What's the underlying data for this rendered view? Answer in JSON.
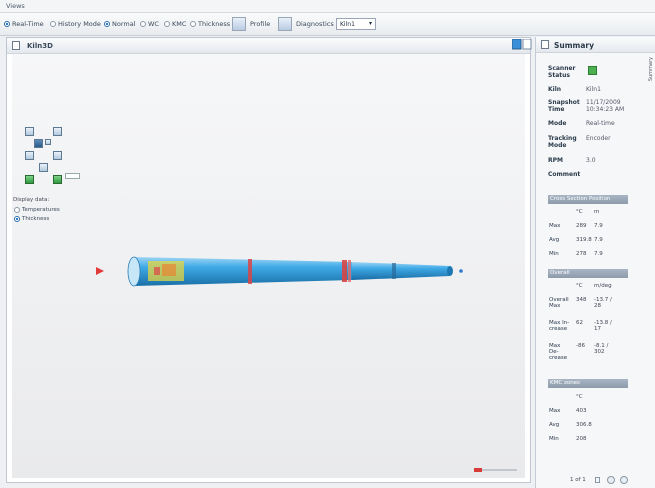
{
  "menu": {
    "label": "Views"
  },
  "toolbar": {
    "modes": [
      {
        "label": "Real-Time",
        "checked": true
      },
      {
        "label": "History Mode",
        "checked": false
      }
    ],
    "display": [
      {
        "label": "Normal",
        "checked": true
      },
      {
        "label": "WC",
        "checked": false
      },
      {
        "label": "KMC",
        "checked": false
      },
      {
        "label": "Thickness",
        "checked": false
      }
    ],
    "profile_label": "Profile",
    "diagnostics_label": "Diagnostics",
    "kiln_select": "Kiln1"
  },
  "view": {
    "title": "Kiln3D",
    "display_title": "Display data:",
    "display_options": [
      {
        "label": "Temperatures",
        "checked": false
      },
      {
        "label": "Thickness",
        "checked": true
      }
    ]
  },
  "summary": {
    "title": "Summary",
    "side_tab": "Summary",
    "status_color": "#4caf50",
    "fields": [
      {
        "key": "Scanner Status",
        "value": ""
      },
      {
        "key": "Kiln",
        "value": "Kiln1"
      },
      {
        "key": "Snapshot Time",
        "value": "11/17/2009 10:34:23 AM"
      },
      {
        "key": "Mode",
        "value": "Real-time"
      },
      {
        "key": "Tracking Mode",
        "value": "Encoder"
      },
      {
        "key": "RPM",
        "value": "3.0"
      },
      {
        "key": "Comment",
        "value": ""
      }
    ],
    "cross_section": {
      "title": "Cross Section Position",
      "units": [
        "°C",
        "m"
      ],
      "rows": [
        {
          "label": "Max",
          "a": "289",
          "b": "7.9"
        },
        {
          "label": "Avg",
          "a": "319.8",
          "b": "7.9"
        },
        {
          "label": "Min",
          "a": "278",
          "b": "7.9"
        }
      ]
    },
    "overall": {
      "title": "Overall",
      "units": [
        "°C",
        "m/deg"
      ],
      "rows": [
        {
          "label": "Overall Max",
          "a": "348",
          "b": "-13.7 / 28"
        },
        {
          "label": "Max In-crease",
          "a": "62",
          "b": "-13.8 / 17"
        },
        {
          "label": "Max De-crease",
          "a": "-86",
          "b": "-8.1 / 302"
        }
      ]
    },
    "kmc_zones": {
      "title": "KMC zones",
      "units": [
        "°C"
      ],
      "rows": [
        {
          "label": "Max",
          "a": "403"
        },
        {
          "label": "Avg",
          "a": "306.8"
        },
        {
          "label": "Min",
          "a": "208"
        }
      ]
    },
    "pager": "1 of 1"
  }
}
